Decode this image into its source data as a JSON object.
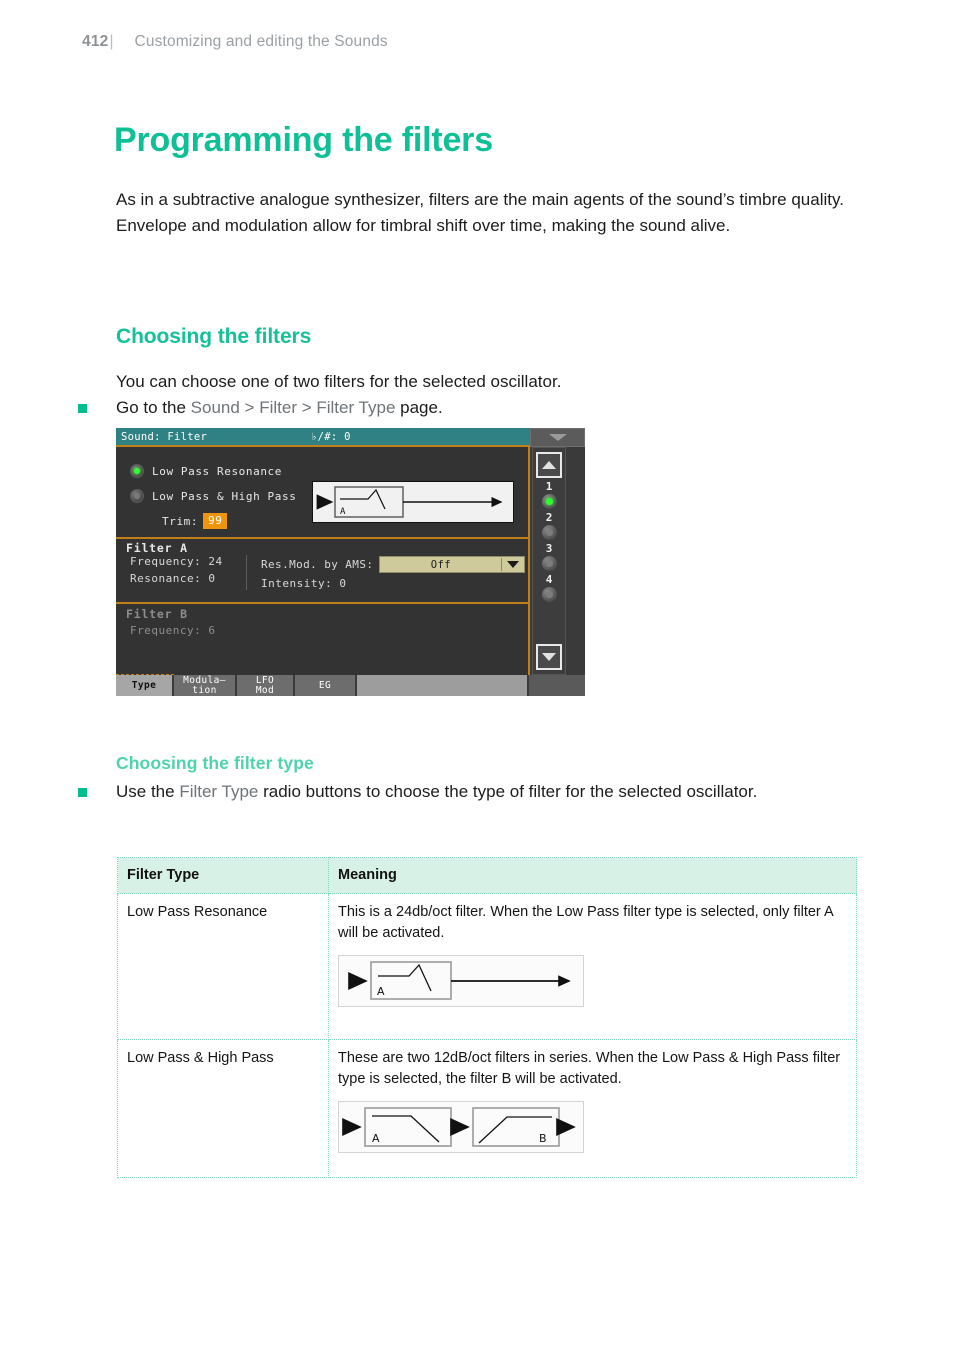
{
  "header": {
    "page_number": "412",
    "separator": "|",
    "title": "Customizing and editing the Sounds"
  },
  "title": "Programming the filters",
  "intro_paragraph": "As in a subtractive analogue synthesizer, filters are the main agents of the sound’s timbre quality. Envelope and modulation allow for timbral shift over time, making the sound alive.",
  "sections": {
    "choosing_filters": {
      "heading": "Choosing the filters",
      "lead": "You can choose one of two filters for the selected oscillator.",
      "bullet_prefix": "Go to the ",
      "bullet_path": "Sound > Filter > Filter Type",
      "bullet_suffix": " page."
    },
    "choosing_filter_type": {
      "heading": "Choosing the filter type",
      "bullet_prefix": "Use the ",
      "bullet_path": "Filter Type",
      "bullet_suffix": " radio buttons to choose the type of filter for the selected oscillator."
    }
  },
  "lcd": {
    "titlebar": {
      "title": "Sound: Filter",
      "meta": "♭/#: 0",
      "menu_icon": "chevron-down-icon"
    },
    "filter_type_radios": [
      {
        "label": "Low Pass Resonance",
        "selected": true
      },
      {
        "label": "Low Pass & High Pass",
        "selected": false
      }
    ],
    "trim": {
      "label": "Trim:",
      "value": "99"
    },
    "flow_diagram": {
      "blocks": [
        {
          "label": "A",
          "shape": "lowpass-resonance"
        }
      ],
      "passthrough": true
    },
    "filter_a": {
      "title": "Filter A",
      "frequency_label": "Frequency:",
      "frequency_value": "24",
      "resonance_label": "Resonance:",
      "resonance_value": "0",
      "ams_label": "Res.Mod. by AMS:",
      "ams_value": "Off",
      "intensity_label": "Intensity:",
      "intensity_value": "0"
    },
    "filter_b": {
      "title": "Filter B",
      "frequency_label": "Frequency:",
      "frequency_value": "6"
    },
    "rail": {
      "up_icon": "triangle-up-icon",
      "down_icon": "triangle-down-icon",
      "items": [
        {
          "number": "1",
          "active": true
        },
        {
          "number": "2",
          "active": false
        },
        {
          "number": "3",
          "active": false
        },
        {
          "number": "4",
          "active": false
        }
      ]
    },
    "tabs": [
      {
        "label": "Type",
        "active": true
      },
      {
        "label": "Modula-\ntion",
        "line1": "Modula—",
        "line2": "tion",
        "active": false
      },
      {
        "label": "LFO Mod",
        "line1": "LFO",
        "line2": "Mod",
        "active": false
      },
      {
        "label": "EG",
        "active": false
      }
    ]
  },
  "table": {
    "headers": [
      "Filter Type",
      "Meaning"
    ],
    "rows": [
      {
        "type": "Low Pass Resonance",
        "meaning": "This is a 24db/oct filter. When the Low Pass filter type is selected, only filter A will be activated.",
        "diagram": {
          "blocks": [
            {
              "label": "A",
              "shape": "lowpass-resonance"
            }
          ]
        }
      },
      {
        "type": "Low Pass & High Pass",
        "meaning": "These are two 12dB/oct filters in series. When the Low Pass & High Pass filter type is selected, the filter B will be activated.",
        "diagram": {
          "blocks": [
            {
              "label": "A",
              "shape": "lowpass"
            },
            {
              "label": "B",
              "shape": "highpass"
            }
          ]
        }
      }
    ]
  },
  "colors": {
    "accent_green": "#0fbf95",
    "subhead_green": "#4fd3ae",
    "table_header_bg": "#d8f1e6",
    "table_border": "#7fd9c4",
    "lcd_titlebar": "#2f8183",
    "lcd_accent": "#c07f18",
    "lcd_body": "#333333",
    "trim_highlight": "#f0940e",
    "dropdown_bg": "#cfca9c",
    "led_on": "#2dff2d"
  }
}
